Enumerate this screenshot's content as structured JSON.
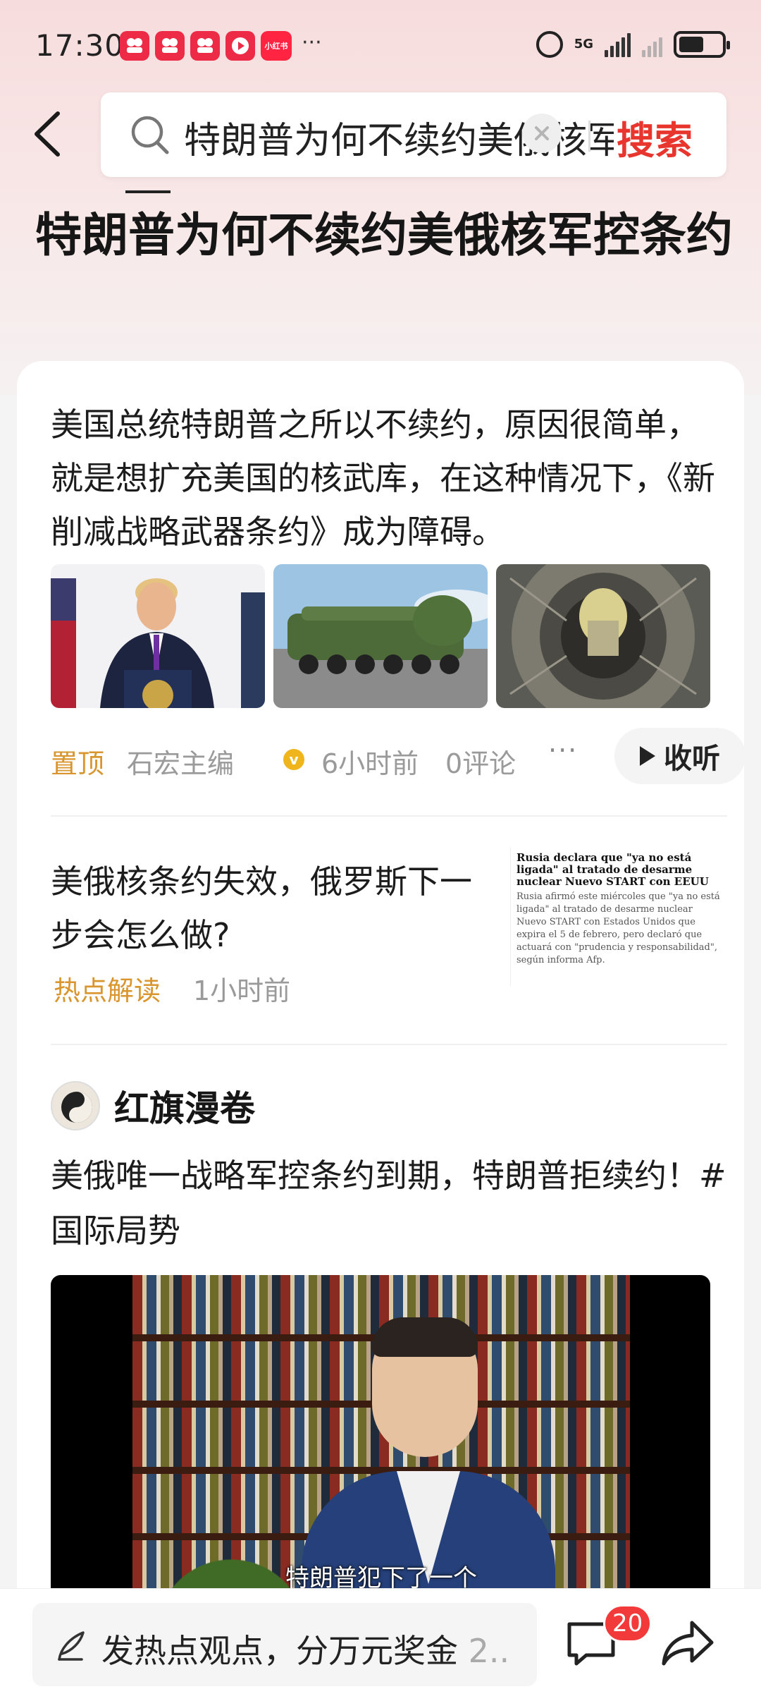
{
  "status_bar": {
    "time": "17:30",
    "app_icons": [
      "领现金",
      "领现金",
      "领现金",
      "play",
      "小红书"
    ],
    "more": "···",
    "network": "5G"
  },
  "search": {
    "query": "特朗普为何不续约美俄核军控条约",
    "search_label": "搜索"
  },
  "page_title": "特朗普为何不续约美俄核军控条约",
  "summary_card": {
    "text": "美国总统特朗普之所以不续约，原因很简单，就是想扩充美国的核武库，在这种情况下，《新削减战略武器条约》成为障碍。",
    "pin_label": "置顶",
    "author": "石宏主编",
    "verified_mark": "v",
    "time": "6小时前",
    "comments": "0评论",
    "more": "···",
    "listen_label": "收听"
  },
  "news_item": {
    "title": "美俄核条约失效，俄罗斯下一步会怎么做?",
    "tag": "热点解读",
    "time": "1小时前",
    "thumb_headline": "Rusia declara que \"ya no está ligada\" al tratado de desarme nuclear Nuevo START con EEUU",
    "thumb_body": "Rusia afirmó este miércoles que \"ya no está ligada\" al tratado de desarme nuclear Nuevo START con Estados Unidos que expira el 5 de febrero, pero declaró que actuará con \"prudencia y responsabilidad\", según informa Afp."
  },
  "post": {
    "author": "红旗漫卷",
    "text": "美俄唯一战略军控条约到期，特朗普拒续约！#国际局势",
    "video_subtitle": "特朗普犯下了一个"
  },
  "bottom_bar": {
    "opinion_text": "发热点观点，分万元奖金",
    "opinion_count": "2..",
    "comment_badge": "20"
  },
  "colors": {
    "accent_red": "#e8352d",
    "tag_orange": "#d9952e",
    "badge_red": "#f23a3a"
  }
}
